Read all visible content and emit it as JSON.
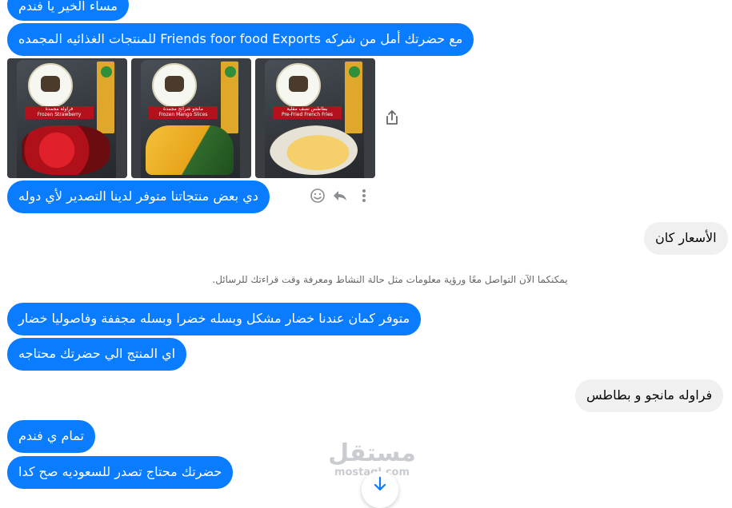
{
  "messages": {
    "m1": "مساء الخير يا فندم",
    "m2": "مع حضرتك أمل من شركه Friends foor food Exports  للمنتجات الغذائيه المجمده",
    "m3": "دي بعض منتجاتنا متوفر لدينا التصدير لأي دوله",
    "m4": "الأسعار كان",
    "m5": "متوفر كمان عندنا خضار مشكل وبسله خضرا وبسله مجففة وفاصوليا خضار",
    "m6": "اي المنتج الي حضرتك محتاجه",
    "m7": "فراوله مانجو و بطاطس",
    "m8": "تمام ي فندم",
    "m9": "حضرتك محتاج تصدر للسعوديه صح كدا"
  },
  "system_note": "يمكنكما الآن التواصل معًا ورؤية معلومات مثل حالة النشاط ومعرفة وقت قراءتك للرسائل.",
  "photos": [
    {
      "label_ar": "فراولة مجمدة",
      "label_en": "Frozen Strawberry"
    },
    {
      "label_ar": "مانجو شرائح مجمدة",
      "label_en": "Frozen Mango Slices"
    },
    {
      "label_ar": "بطاطس نصف مقلية",
      "label_en": "Pre-Fried French Fries"
    }
  ],
  "icons": {
    "share": "share-icon",
    "more": "more-vertical-icon",
    "reply": "reply-icon",
    "react": "smiley-icon",
    "scroll": "arrow-down-icon"
  },
  "watermark": {
    "arabic": "مستقل",
    "latin": "mostaql.com"
  },
  "colors": {
    "outgoing": "#0a7cff",
    "incoming": "#f0f0f0"
  }
}
